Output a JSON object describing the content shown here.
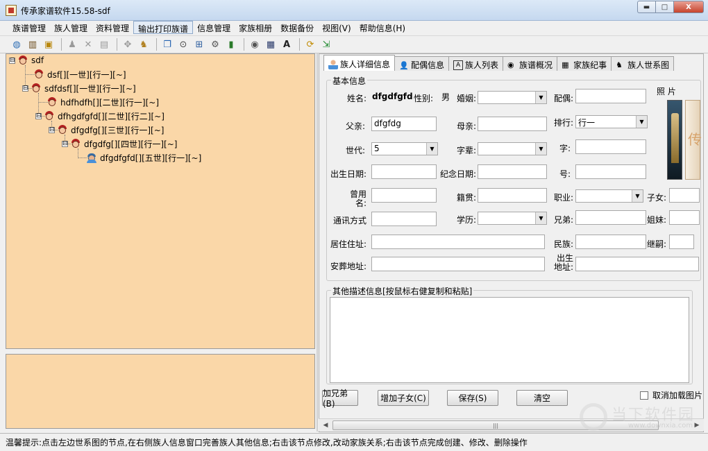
{
  "window": {
    "title": "传承家谱软件15.58-sdf",
    "min": "▬",
    "max": "□",
    "close": "X"
  },
  "menu": [
    "族谱管理",
    "族人管理",
    "资料管理",
    "输出打印族谱",
    "信息管理",
    "家族相册",
    "数据备份",
    "视图(V)",
    "帮助信息(H)"
  ],
  "tree": {
    "nodes": [
      {
        "label": "sdf",
        "expander": "⊟"
      },
      {
        "label": "dsf[][一世][行一][~]",
        "expander": ""
      },
      {
        "label": "sdfdsf[][一世][行一][~]",
        "expander": "⊟"
      },
      {
        "label": "hdfhdfh[][二世][行一][~]",
        "expander": ""
      },
      {
        "label": "dfhgdfgfd[][二世][行二][~]",
        "expander": "⊟"
      },
      {
        "label": "dfgdfg[][三世][行一][~]",
        "expander": "⊟"
      },
      {
        "label": "dfgdfg[][四世][行一][~]",
        "expander": "⊟"
      },
      {
        "label": "dfgdfgfd[][五世][行一][~]",
        "expander": ""
      }
    ]
  },
  "tabs": [
    "族人详细信息",
    "配偶信息",
    "族人列表",
    "族谱概况",
    "家族纪事",
    "族人世系图"
  ],
  "basic": {
    "legend": "基本信息",
    "name_label": "姓名:",
    "name_value": "dfgdfgfd",
    "gender_label": "性别:",
    "gender_value": "男",
    "marriage_label": "婚姻:",
    "spouse_label": "配偶:",
    "photo_label": "照  片",
    "father_label": "父亲:",
    "father_value": "dfgfdg",
    "mother_label": "母亲:",
    "rank_label": "排行:",
    "rank_value": "行一",
    "gen_label": "世代:",
    "gen_value": "5",
    "zibei_label": "字辈:",
    "zi_label": "字:",
    "birth_label": "出生日期:",
    "memorial_label": "纪念日期:",
    "hao_label": "号:",
    "formername_label": "曾用名:",
    "jiguan_label": "籍贯:",
    "job_label": "职业:",
    "children_label": "子女:",
    "contact_label": "通讯方式",
    "edu_label": "学历:",
    "brothers_label": "兄弟:",
    "sisters_label": "姐妹:",
    "address_label": "居住住址:",
    "ethnic_label": "民族:",
    "heir_label": "继嗣:",
    "burial_label": "安葬地址:",
    "birthplace_label": "出生地址:"
  },
  "other": {
    "legend": "其他描述信息[按鼠标右健复制和粘贴]"
  },
  "buttons": {
    "add_brother": "加兄弟(B)",
    "add_child": "增加子女(C)",
    "save": "保存(S)",
    "clear": "清空"
  },
  "cancel_load_image": "取消加载图片",
  "scroll_grip": "|||",
  "status": "温馨提示:点击左边世系图的节点,在右侧族人信息窗口完善族人其他信息;右击该节点修改,改动家族关系;右击该节点完成创建、修改、删除操作",
  "watermark": {
    "brand": "当下软件园",
    "url": "www.downxia.com"
  }
}
